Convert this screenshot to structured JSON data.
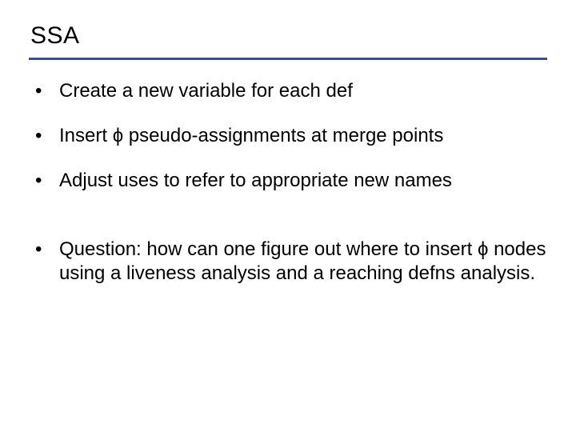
{
  "slide": {
    "title": "SSA",
    "bullets": [
      "Create a new variable for each def",
      "Insert ϕ pseudo-assignments at merge points",
      "Adjust uses to refer to appropriate new names",
      "Question: how can one figure out where to insert ϕ nodes using a liveness analysis and a reaching defns analysis."
    ],
    "accent_color": "#3a4e8a"
  }
}
